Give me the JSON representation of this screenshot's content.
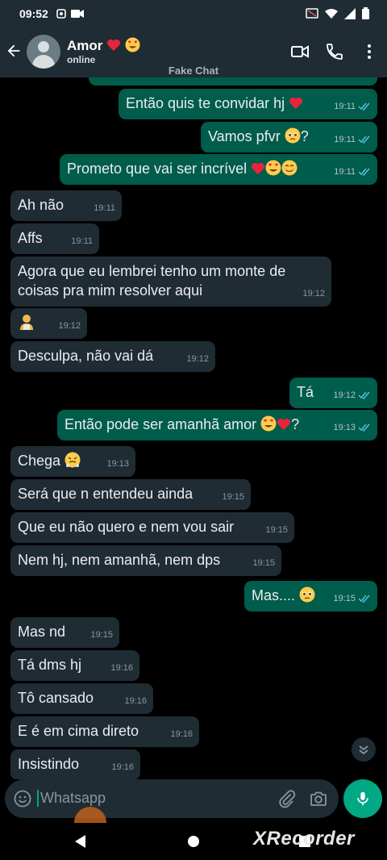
{
  "status_bar": {
    "time": "09:52"
  },
  "header": {
    "contact_name": "Amor",
    "contact_status": "online"
  },
  "watermark": "Fake Chat",
  "messages": [
    {
      "dir": "out",
      "text": "Então quis te convidar hj",
      "time": "19:11"
    },
    {
      "dir": "out",
      "text": "Vamos pfvr",
      "time": "19:11"
    },
    {
      "dir": "out",
      "text": "Prometo que vai ser incrível",
      "time": "19:11"
    },
    {
      "dir": "in",
      "text": "Ah não",
      "time": "19:11"
    },
    {
      "dir": "in",
      "text": "Affs",
      "time": "19:11"
    },
    {
      "dir": "in",
      "text": "Agora que eu lembrei tenho um monte de coisas pra mim resolver aqui",
      "time": "19:12"
    },
    {
      "dir": "in",
      "text": "",
      "time": "19:12"
    },
    {
      "dir": "in",
      "text": "Desculpa, não vai dá",
      "time": "19:12"
    },
    {
      "dir": "out",
      "text": "Tá",
      "time": "19:12"
    },
    {
      "dir": "out",
      "text": "Então pode ser amanhã amor",
      "time": "19:13"
    },
    {
      "dir": "in",
      "text": "Chega",
      "time": "19:13"
    },
    {
      "dir": "in",
      "text": "Será que n entendeu ainda",
      "time": "19:15"
    },
    {
      "dir": "in",
      "text": "Que eu não quero e nem vou sair",
      "time": "19:15"
    },
    {
      "dir": "in",
      "text": "Nem hj, nem amanhã, nem dps",
      "time": "19:15"
    },
    {
      "dir": "out",
      "text": "Mas....",
      "time": "19:15"
    },
    {
      "dir": "in",
      "text": "Mas nd",
      "time": "19:15"
    },
    {
      "dir": "in",
      "text": "Tá dms hj",
      "time": "19:16"
    },
    {
      "dir": "in",
      "text": "Tô cansado",
      "time": "19:16"
    },
    {
      "dir": "in",
      "text": "E é em cima direto",
      "time": "19:16"
    },
    {
      "dir": "in",
      "text": "Insistindo",
      "time": "19:16"
    }
  ],
  "input": {
    "placeholder": "Whatsapp"
  },
  "recorder_watermark": "XRecorder",
  "colors": {
    "outgoing": "#005c4b",
    "incoming": "#202c33",
    "accent": "#00a884",
    "read_ticks": "#53bdeb"
  }
}
